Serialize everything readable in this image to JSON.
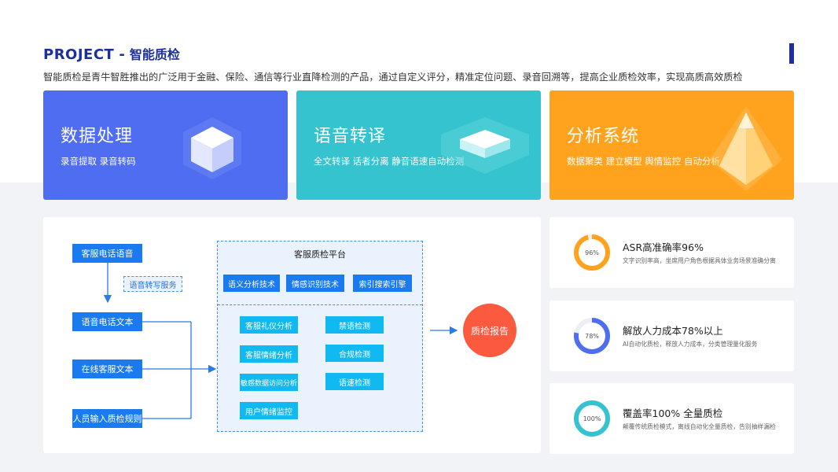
{
  "header": {
    "title_en": "PROJECT",
    "title_dash": "-",
    "title_cn": "智能质检",
    "subtitle": "智能质检是青牛智胜推出的广泛用于金融、保险、通信等行业直降检测的产品，通过自定义评分，精准定位问题、录音回溯等，提高企业质检效率，实现高质高效质检"
  },
  "cards": [
    {
      "title": "数据处理",
      "desc": "录音提取  录音转码",
      "color": "#4f6df0",
      "icon": "cube-icon"
    },
    {
      "title": "语音转译",
      "desc": "全文转译  话者分离  静音语速自动检测",
      "color": "#35c4cf",
      "icon": "slab-icon"
    },
    {
      "title": "分析系统",
      "desc": "数据聚类  建立模型  舆情监控  自动分析",
      "color": "#ffa31f",
      "icon": "pyramid-icon"
    }
  ],
  "diagram": {
    "inputs": [
      "客服电话语音",
      "语音电话文本",
      "在线客服文本",
      "人员输入质检规则"
    ],
    "transcribe_service": "语音转写服务",
    "platform_title": "客服质检平台",
    "technologies": [
      "语义分析技术",
      "情感识别技术",
      "索引搜索引擎"
    ],
    "checks_left": [
      "客服礼仪分析",
      "客服情绪分析",
      "敏感数据访问分析",
      "用户情绪监控"
    ],
    "checks_right": [
      "禁语检测",
      "合规检测",
      "语速检测"
    ],
    "output": "质检报告"
  },
  "stats": [
    {
      "label": "96%",
      "value": 0.96,
      "color": "#ffa31f",
      "title": "ASR高准确率96%",
      "desc": "文字识别率高，坐席用户角色根据具体业务场景准确分离"
    },
    {
      "label": "78%",
      "value": 0.78,
      "color": "#4f6df0",
      "title": "解放人力成本78%以上",
      "desc": "AI自动化质检，释放人力成本，分类管理量化服务"
    },
    {
      "label": "100%",
      "value": 1.0,
      "color": "#35c4cf",
      "title": "覆盖率100% 全量质检",
      "desc": "颠覆传统质检模式，离线自动化全量质检，告别抽样漏检"
    }
  ]
}
